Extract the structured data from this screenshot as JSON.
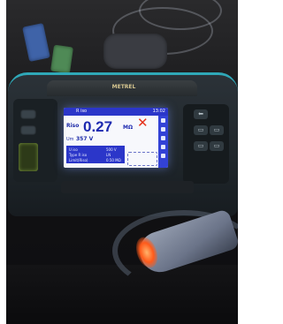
{
  "meter": {
    "brand": "METREL",
    "screen": {
      "title": "R iso",
      "time": "13:02",
      "measure_label": "Riso",
      "main_value": "0.27",
      "main_unit": "MΩ",
      "status_symbol": "✕",
      "sub_label": "Um",
      "sub_value": "357 V",
      "info_lines": [
        "U iso",
        "Type R iso",
        "Limit(Riso)"
      ],
      "info_right": [
        "500 V",
        "LN",
        "0.50 MΩ"
      ]
    },
    "right_buttons": [
      "⬅",
      "▭",
      "▭",
      "▭",
      "▭"
    ]
  },
  "colors": {
    "screen_accent": "#2b36c9",
    "value_text": "#1e2ab0",
    "fail_red": "#e5341d",
    "probe_light": "#ff5a1a",
    "meter_trim": "#2fa8b8"
  }
}
